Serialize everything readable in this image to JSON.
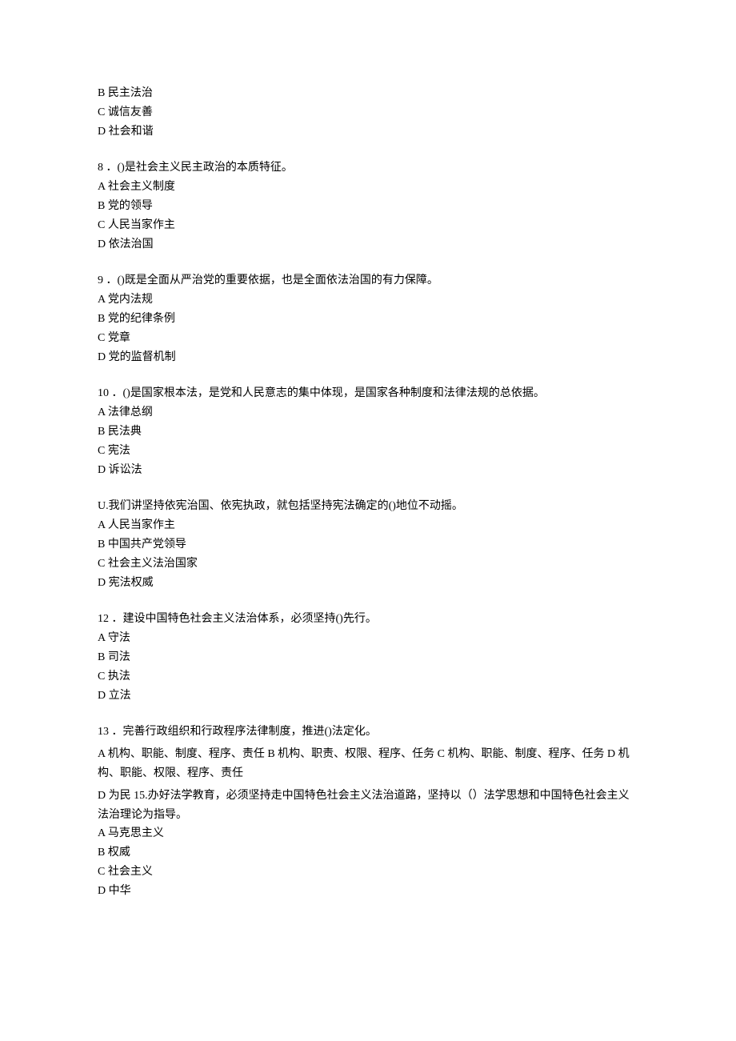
{
  "q7_tail": {
    "options": [
      "B 民主法治",
      "C 诚信友善",
      "D 社会和谐"
    ]
  },
  "q8": {
    "stem": "8 ．()是社会主义民主政治的本质特征。",
    "options": [
      "A 社会主义制度",
      "B 党的领导",
      "C 人民当家作主",
      "D 依法治国"
    ]
  },
  "q9": {
    "stem": "9 ．()既是全面从严治党的重要依据，也是全面依法治国的有力保障。",
    "options": [
      "A 党内法规",
      "B 党的纪律条例",
      "C 党章",
      "D 党的监督机制"
    ]
  },
  "q10": {
    "stem": "10 ．()是国家根本法，是党和人民意志的集中体现，是国家各种制度和法律法规的总依据。",
    "options": [
      "A 法律总纲",
      "B 民法典",
      "C 宪法",
      "D 诉讼法"
    ]
  },
  "q11": {
    "stem": "U.我们讲坚持依宪治国、依宪执政，就包括坚持宪法确定的()地位不动摇。",
    "options": [
      "A 人民当家作主",
      "B 中国共产党领导",
      "C 社会主义法治国家",
      "D 宪法权威"
    ]
  },
  "q12": {
    "stem": "12 ．建设中国特色社会主义法治体系，必须坚持()先行。",
    "options": [
      "A 守法",
      "B 司法",
      "C 执法",
      "D 立法"
    ]
  },
  "q13": {
    "stem": "13 ．完善行政组织和行政程序法律制度，推进()法定化。",
    "line2": "A 机构、职能、制度、程序、责任 B 机构、职责、权限、程序、任务 C 机构、职能、制度、程序、任务 D 机构、职能、权限、程序、责任",
    "line3": "D 为民 15.办好法学教育，必须坚持走中国特色社会主义法治道路，坚持以（）法学思想和中国特色社会主义法治理论为指导。",
    "options": [
      "A 马克思主义",
      "B 权威",
      "C 社会主义",
      "D 中华"
    ]
  }
}
